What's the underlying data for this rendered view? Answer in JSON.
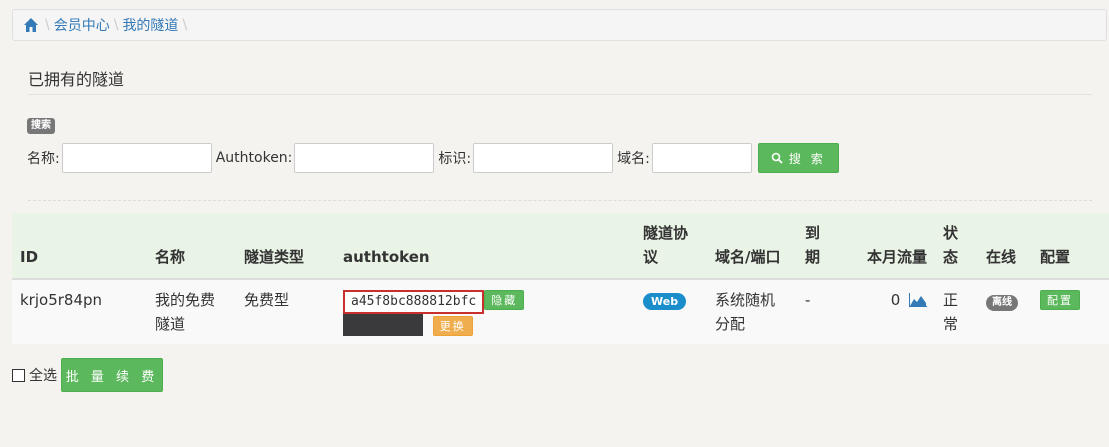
{
  "breadcrumb": {
    "items": [
      "会员中心",
      "我的隧道"
    ]
  },
  "page_title": "已拥有的隧道",
  "search": {
    "badge": "搜索",
    "fields": [
      {
        "label": "名称:",
        "value": ""
      },
      {
        "label": "Authtoken:",
        "value": ""
      },
      {
        "label": "标识:",
        "value": ""
      },
      {
        "label": "域名:",
        "value": ""
      }
    ],
    "button_label": "搜 索"
  },
  "table": {
    "headers": [
      "ID",
      "名称",
      "隧道类型",
      "authtoken",
      "隧道协议",
      "域名/端口",
      "到期",
      "本月流量",
      "状态",
      "在线",
      "配置"
    ],
    "rows": [
      {
        "id": "krjo5r84pn",
        "name": "我的免费隧道",
        "type": "免费型",
        "authtoken": "a45f8bc888812bfc",
        "hide_btn": "隐藏",
        "change_btn": "更换",
        "protocol": "Web",
        "domain": "系统随机分配",
        "expiry": "-",
        "traffic": "0",
        "status": "正常",
        "online": "离线",
        "config_btn": "配置"
      }
    ]
  },
  "footer": {
    "select_all": "全选",
    "batch_button": "批 量 续 费"
  },
  "colors": {
    "link": "#337ab7",
    "green": "#5cb85c",
    "orange": "#f0ad4e",
    "web_badge": "#1a8ecb",
    "header_bg": "#e9f3e6"
  }
}
